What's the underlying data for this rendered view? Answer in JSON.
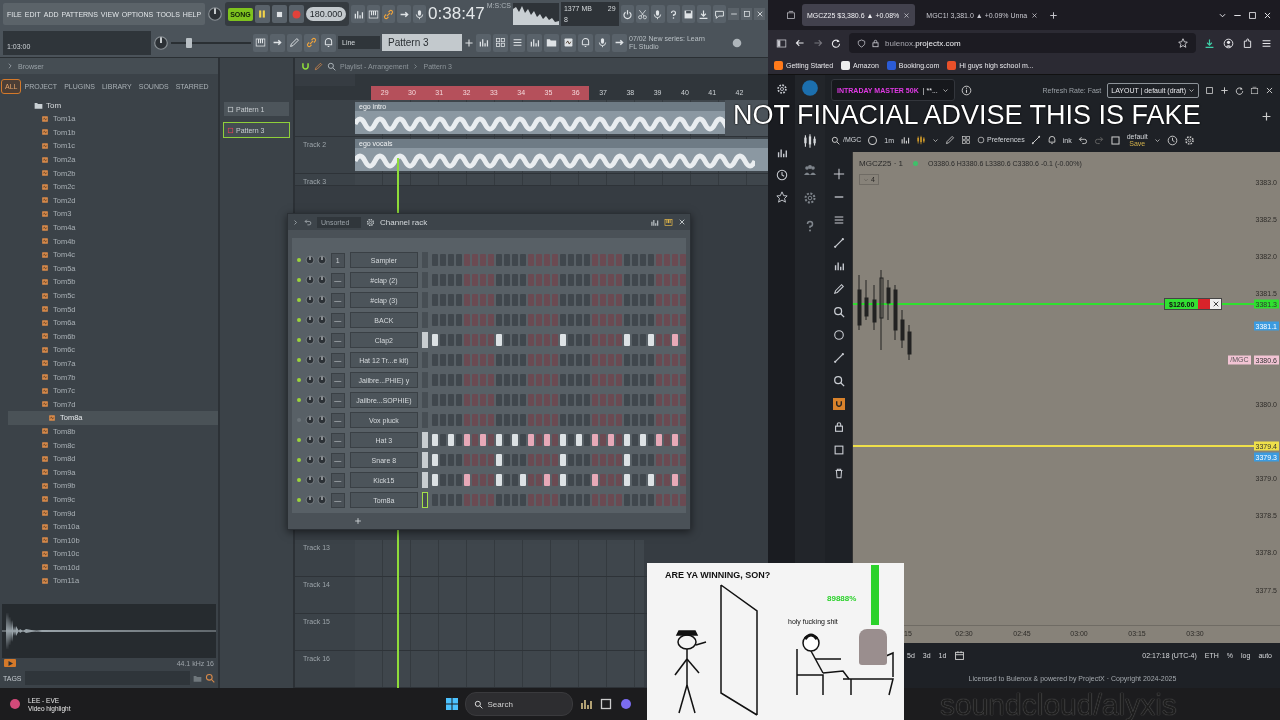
{
  "daw": {
    "menu": [
      "FILE",
      "EDIT",
      "ADD",
      "PATTERNS",
      "VIEW",
      "OPTIONS",
      "TOOLS",
      "HELP"
    ],
    "song_mode": {
      "label": "SONG",
      "on": true
    },
    "tempo": "180.000",
    "time": "0:38:47",
    "time_format": "M:S:CS",
    "cpu": "29",
    "memory": "1377 MB",
    "polyphony": "8",
    "hint_value": "1:03:00",
    "master_volume": {
      "level": 0.2
    },
    "snap": "Line",
    "pattern": "Pattern 3",
    "news": {
      "title": "07/02  New series: Learn",
      "subtitle": "FL Studio"
    },
    "browser": {
      "title": "Browser",
      "tabs": [
        {
          "label": "ALL",
          "selected": true
        },
        {
          "label": "PROJECT",
          "selected": false
        },
        {
          "label": "PLUGINS",
          "selected": false
        },
        {
          "label": "LIBRARY",
          "selected": false
        },
        {
          "label": "SOUNDS",
          "selected": false
        },
        {
          "label": "STARRED",
          "selected": false
        }
      ],
      "tree": {
        "label": "Tom",
        "children": [
          {
            "label": "Tom1a",
            "selected": false
          },
          {
            "label": "Tom1b",
            "selected": false
          },
          {
            "label": "Tom1c",
            "selected": false
          },
          {
            "label": "Tom2a",
            "selected": false
          },
          {
            "label": "Tom2b",
            "selected": false
          },
          {
            "label": "Tom2c",
            "selected": false
          },
          {
            "label": "Tom2d",
            "selected": false
          },
          {
            "label": "Tom3",
            "selected": false
          },
          {
            "label": "Tom4a",
            "selected": false
          },
          {
            "label": "Tom4b",
            "selected": false
          },
          {
            "label": "Tom4c",
            "selected": false
          },
          {
            "label": "Tom5a",
            "selected": false
          },
          {
            "label": "Tom5b",
            "selected": false
          },
          {
            "label": "Tom5c",
            "selected": false
          },
          {
            "label": "Tom5d",
            "selected": false
          },
          {
            "label": "Tom6a",
            "selected": false
          },
          {
            "label": "Tom6b",
            "selected": false
          },
          {
            "label": "Tom6c",
            "selected": false
          },
          {
            "label": "Tom7a",
            "selected": false
          },
          {
            "label": "Tom7b",
            "selected": false
          },
          {
            "label": "Tom7c",
            "selected": false
          },
          {
            "label": "Tom7d",
            "selected": false
          },
          {
            "label": "Tom8a",
            "selected": true
          },
          {
            "label": "Tom8b",
            "selected": false
          },
          {
            "label": "Tom8c",
            "selected": false
          },
          {
            "label": "Tom8d",
            "selected": false
          },
          {
            "label": "Tom9a",
            "selected": false
          },
          {
            "label": "Tom9b",
            "selected": false
          },
          {
            "label": "Tom9c",
            "selected": false
          },
          {
            "label": "Tom9d",
            "selected": false
          },
          {
            "label": "Tom10a",
            "selected": false
          },
          {
            "label": "Tom10b",
            "selected": false
          },
          {
            "label": "Tom10c",
            "selected": false
          },
          {
            "label": "Tom10d",
            "selected": false
          },
          {
            "label": "Tom11a",
            "selected": false
          }
        ]
      },
      "sample_info": "44.1 kHz 16",
      "tags_label": "TAGS"
    },
    "patterns": [
      {
        "label": "Pattern 1",
        "selected": false
      },
      {
        "label": "Pattern 3",
        "selected": true
      }
    ],
    "playlist": {
      "title": "Playlist - Arrangement",
      "pattern": "Pattern 3",
      "ruler": [
        {
          "label": "29",
          "in_loop": true
        },
        {
          "label": "30",
          "in_loop": true
        },
        {
          "label": "31",
          "in_loop": true
        },
        {
          "label": "32",
          "in_loop": true
        },
        {
          "label": "33",
          "in_loop": true
        },
        {
          "label": "34",
          "in_loop": true
        },
        {
          "label": "35",
          "in_loop": true
        },
        {
          "label": "36",
          "in_loop": true
        },
        {
          "label": "37",
          "in_loop": false
        },
        {
          "label": "38",
          "in_loop": false
        },
        {
          "label": "39",
          "in_loop": false
        },
        {
          "label": "40",
          "in_loop": false
        },
        {
          "label": "41",
          "in_loop": false
        },
        {
          "label": "42",
          "in_loop": false
        }
      ],
      "top_tracks": [
        {
          "clip": "ego intro"
        },
        {
          "label": "Track 2",
          "clip": "ego vocals"
        },
        {
          "label": "Track 3"
        }
      ],
      "bottom_tracks": [
        {
          "label": "Track 13"
        },
        {
          "label": "Track 14"
        },
        {
          "label": "Track 15"
        },
        {
          "label": "Track 16"
        }
      ]
    },
    "channel_rack": {
      "title": "Channel rack",
      "filter": "Unsorted",
      "channels": [
        {
          "name": "Sampler",
          "mixer": "1",
          "led_on": true,
          "selected": false,
          "focused": false,
          "steps": [
            false,
            false,
            false,
            false,
            false,
            false,
            false,
            false,
            false,
            false,
            false,
            false,
            false,
            false,
            false,
            false,
            false,
            false,
            false,
            false,
            false,
            false,
            false,
            false,
            false,
            false,
            false,
            false,
            false,
            false,
            false,
            false
          ]
        },
        {
          "name": "#clap (2)",
          "mixer": "—",
          "led_on": true,
          "selected": false,
          "focused": false,
          "steps": [
            false,
            false,
            false,
            false,
            false,
            false,
            false,
            false,
            false,
            false,
            false,
            false,
            false,
            false,
            false,
            false,
            false,
            false,
            false,
            false,
            false,
            false,
            false,
            false,
            false,
            false,
            false,
            false,
            false,
            false,
            false,
            false
          ]
        },
        {
          "name": "#clap (3)",
          "mixer": "—",
          "led_on": true,
          "selected": false,
          "focused": false,
          "steps": [
            false,
            false,
            false,
            false,
            false,
            false,
            false,
            false,
            false,
            false,
            false,
            false,
            false,
            false,
            false,
            false,
            false,
            false,
            false,
            false,
            false,
            false,
            false,
            false,
            false,
            false,
            false,
            false,
            false,
            false,
            false,
            false
          ]
        },
        {
          "name": "BACK",
          "mixer": "—",
          "led_on": true,
          "selected": false,
          "focused": false,
          "steps": [
            false,
            false,
            false,
            false,
            false,
            false,
            false,
            false,
            false,
            false,
            false,
            false,
            false,
            false,
            false,
            false,
            false,
            false,
            false,
            false,
            false,
            false,
            false,
            false,
            false,
            false,
            false,
            false,
            false,
            false,
            false,
            false
          ]
        },
        {
          "name": "Clap2",
          "mixer": "—",
          "led_on": true,
          "selected": true,
          "focused": false,
          "steps": [
            true,
            false,
            false,
            false,
            false,
            false,
            false,
            false,
            true,
            false,
            false,
            false,
            false,
            false,
            false,
            false,
            true,
            false,
            false,
            false,
            false,
            false,
            false,
            false,
            true,
            false,
            false,
            true,
            false,
            false,
            true,
            false
          ]
        },
        {
          "name": "Hat 12 Tr...e kit)",
          "mixer": "—",
          "led_on": true,
          "selected": false,
          "focused": false,
          "steps": [
            false,
            false,
            false,
            false,
            false,
            false,
            false,
            false,
            false,
            false,
            false,
            false,
            false,
            false,
            false,
            false,
            false,
            false,
            false,
            false,
            false,
            false,
            false,
            false,
            false,
            false,
            false,
            false,
            false,
            false,
            false,
            false
          ]
        },
        {
          "name": "Jailbre...PHIE) y",
          "mixer": "—",
          "led_on": true,
          "selected": false,
          "focused": false,
          "steps": [
            false,
            false,
            false,
            false,
            false,
            false,
            false,
            false,
            false,
            false,
            false,
            false,
            false,
            false,
            false,
            false,
            false,
            false,
            false,
            false,
            false,
            false,
            false,
            false,
            false,
            false,
            false,
            false,
            false,
            false,
            false,
            false
          ]
        },
        {
          "name": "Jailbre...SOPHIE)",
          "mixer": "—",
          "led_on": true,
          "selected": false,
          "focused": false,
          "steps": [
            false,
            false,
            false,
            false,
            false,
            false,
            false,
            false,
            false,
            false,
            false,
            false,
            false,
            false,
            false,
            false,
            false,
            false,
            false,
            false,
            false,
            false,
            false,
            false,
            false,
            false,
            false,
            false,
            false,
            false,
            false,
            false
          ]
        },
        {
          "name": "Vox pluck",
          "mixer": "—",
          "led_on": false,
          "selected": false,
          "focused": false,
          "steps": [
            false,
            false,
            false,
            false,
            false,
            false,
            false,
            false,
            false,
            false,
            false,
            false,
            false,
            false,
            false,
            false,
            false,
            false,
            false,
            false,
            false,
            false,
            false,
            false,
            false,
            false,
            false,
            false,
            false,
            false,
            false,
            false
          ]
        },
        {
          "name": "Hat 3",
          "mixer": "—",
          "led_on": true,
          "selected": true,
          "focused": false,
          "steps": [
            true,
            false,
            true,
            false,
            true,
            false,
            true,
            false,
            true,
            false,
            true,
            false,
            true,
            false,
            true,
            false,
            true,
            false,
            true,
            false,
            true,
            false,
            true,
            false,
            true,
            false,
            true,
            false,
            true,
            false,
            true,
            false
          ]
        },
        {
          "name": "Snare 8",
          "mixer": "—",
          "led_on": true,
          "selected": true,
          "focused": false,
          "steps": [
            true,
            false,
            false,
            false,
            false,
            false,
            false,
            false,
            true,
            false,
            false,
            false,
            false,
            false,
            false,
            false,
            true,
            false,
            false,
            false,
            false,
            false,
            false,
            false,
            true,
            false,
            false,
            false,
            false,
            false,
            false,
            false
          ]
        },
        {
          "name": "Kick15",
          "mixer": "—",
          "led_on": true,
          "selected": true,
          "focused": false,
          "steps": [
            true,
            false,
            false,
            false,
            true,
            false,
            false,
            false,
            true,
            false,
            false,
            true,
            false,
            false,
            true,
            false,
            true,
            false,
            false,
            false,
            true,
            false,
            false,
            false,
            true,
            false,
            false,
            true,
            false,
            false,
            true,
            false
          ]
        },
        {
          "name": "Tom8a",
          "mixer": "—",
          "led_on": true,
          "selected": false,
          "focused": true,
          "steps": [
            false,
            false,
            false,
            false,
            false,
            false,
            false,
            false,
            false,
            false,
            false,
            false,
            false,
            false,
            false,
            false,
            false,
            false,
            false,
            false,
            false,
            false,
            false,
            false,
            false,
            false,
            false,
            false,
            false,
            false,
            false,
            false
          ]
        }
      ]
    }
  },
  "web": {
    "tabs": [
      {
        "label": "MGCZ25 $3,380.6 ▲ +0.08%",
        "selected": true
      },
      {
        "label": "MGC1! 3,381.0 ▲ +0.09% Unna",
        "selected": false
      }
    ],
    "url": "bulenox.**projectx.com**",
    "bookmarks": [
      "Getting Started",
      "Amazon",
      "Booking.com",
      "Hi guys high school m..."
    ],
    "account": {
      "name": "INTRADAY MASTER 50K",
      "id": "| **..."
    },
    "refresh": "Refresh Rate: Fast",
    "layout": "LAYOUT | default (draft)",
    "toolbar": {
      "symbol": "/MGC",
      "interval": "1m",
      "preferences": "Preferences",
      "ink": "ink",
      "template": "default",
      "save": "Save"
    },
    "chart": {
      "symbol": "MGCZ25 · 1",
      "ohlc": "O3380.6 H3380.6 L3380.6 C3380.6 -0.1 (-0.00%)",
      "indicators": "4",
      "y_ticks": [
        "3383.0",
        "3382.5",
        "3382.0",
        "3381.5",
        "3380.0",
        "3379.0",
        "3378.5",
        "3378.0",
        "3377.5"
      ],
      "x_ticks": [
        "15",
        "02:30",
        "02:45",
        "03:00",
        "03:15",
        "03:30"
      ],
      "position": "$126.00",
      "price_tags": [
        {
          "label": "3381.3",
          "kind": "level-line",
          "color": "#2fe02f"
        },
        {
          "label": "3381.1",
          "kind": "marker",
          "color": "#3b9be0"
        },
        {
          "label": "3380.6",
          "symbol": "/MGC",
          "kind": "marker",
          "color": "#f2c4d4"
        },
        {
          "label": "3379.4",
          "kind": "level-line",
          "color": "#efe04a"
        },
        {
          "label": "3379.3",
          "kind": "marker",
          "color": "#3b9be0"
        }
      ]
    },
    "ranges": [
      "5d",
      "3d",
      "1d"
    ],
    "clock": "02:17:18 (UTC-4)",
    "session": "ETH",
    "scale_options": [
      "%",
      "log",
      "auto"
    ],
    "footer": "Licensed to Bulenox & powered by ProjectX · Copyright 2024-2025"
  },
  "taskbar": {
    "media": {
      "title": "LEE - EVE",
      "subtitle": "Video highlight"
    },
    "search": {
      "placeholder": "Search"
    }
  },
  "meme": {
    "caption": "ARE YA WINNING, SON?",
    "percent": "89888%",
    "reaction": "holy fucking shit"
  },
  "overlays": {
    "caption": "NOT FINACIAL ADVISE THIS IS FAKE",
    "tag": "soundcloud/alyxis"
  }
}
